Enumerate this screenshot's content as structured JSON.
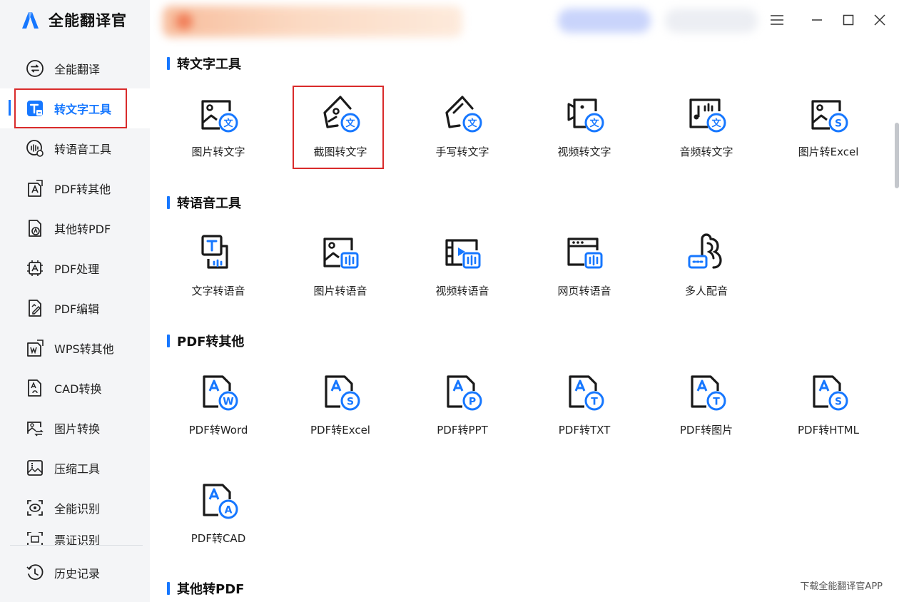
{
  "app": {
    "name": "全能翻译官"
  },
  "colors": {
    "accent": "#1677ff",
    "highlight": "#d92b2b",
    "sidebar_bg": "#f4f5f7"
  },
  "sidebar": {
    "items": [
      {
        "label": "全能翻译",
        "icon": "translate-icon"
      },
      {
        "label": "转文字工具",
        "icon": "text-tool-icon",
        "active": true
      },
      {
        "label": "转语音工具",
        "icon": "voice-icon"
      },
      {
        "label": "PDF转其他",
        "icon": "pdf-export-icon"
      },
      {
        "label": "其他转PDF",
        "icon": "to-pdf-icon"
      },
      {
        "label": "PDF处理",
        "icon": "pdf-process-icon"
      },
      {
        "label": "PDF编辑",
        "icon": "pdf-edit-icon"
      },
      {
        "label": "WPS转其他",
        "icon": "wps-icon"
      },
      {
        "label": "CAD转换",
        "icon": "cad-icon"
      },
      {
        "label": "图片转换",
        "icon": "image-convert-icon"
      },
      {
        "label": "压缩工具",
        "icon": "compress-icon"
      },
      {
        "label": "全能识别",
        "icon": "recognize-icon"
      },
      {
        "label": "票证识别",
        "icon": "ticket-icon"
      }
    ],
    "history": {
      "label": "历史记录",
      "icon": "history-icon"
    }
  },
  "sections": [
    {
      "title": "转文字工具",
      "tools": [
        "图片转文字",
        "截图转文字",
        "手写转文字",
        "视频转文字",
        "音频转文字",
        "图片转Excel"
      ]
    },
    {
      "title": "转语音工具",
      "tools": [
        "文字转语音",
        "图片转语音",
        "视频转语音",
        "网页转语音",
        "多人配音"
      ]
    },
    {
      "title": "PDF转其他",
      "tools": [
        "PDF转Word",
        "PDF转Excel",
        "PDF转PPT",
        "PDF转TXT",
        "PDF转图片",
        "PDF转HTML",
        "PDF转CAD"
      ]
    },
    {
      "title": "其他转PDF",
      "tools": []
    }
  ],
  "footer": {
    "download": "下载全能翻译官APP"
  }
}
